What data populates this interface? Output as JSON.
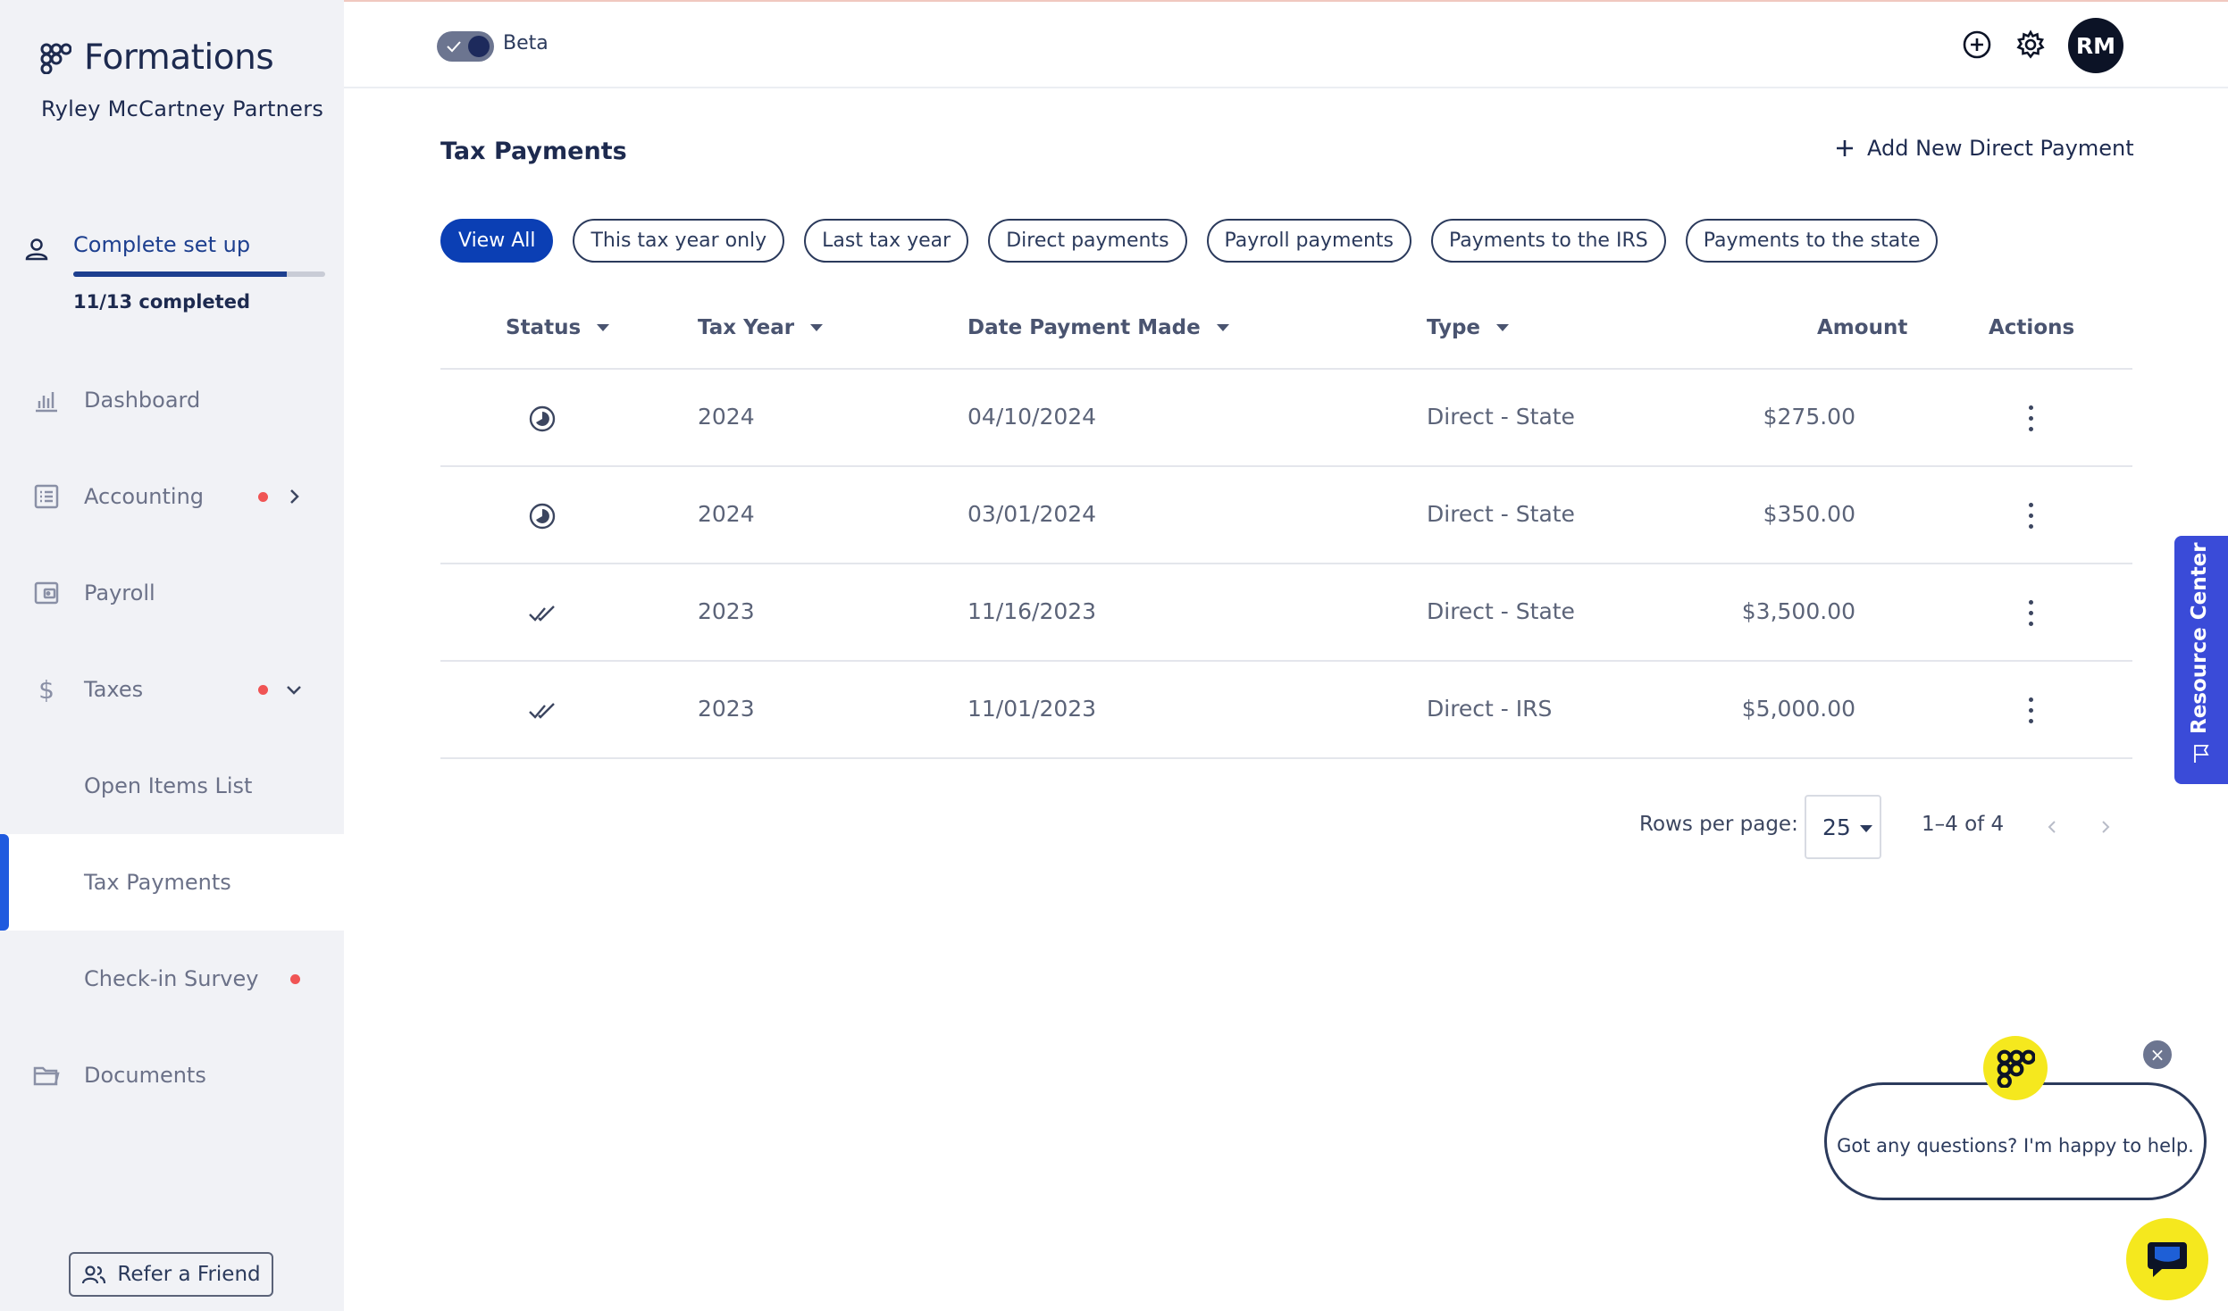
{
  "brand": {
    "name": "Formations",
    "company": "Ryley McCartney Partners"
  },
  "setup": {
    "label": "Complete set up",
    "count": "11/13 completed",
    "progress": 0.846
  },
  "nav": {
    "dashboard": "Dashboard",
    "accounting": "Accounting",
    "payroll": "Payroll",
    "taxes": "Taxes",
    "open_items": "Open Items List",
    "tax_payments": "Tax Payments",
    "checkin": "Check-in Survey",
    "documents": "Documents"
  },
  "refer": "Refer a Friend",
  "header": {
    "beta_label": "Beta",
    "avatar_initials": "RM"
  },
  "main": {
    "title": "Tax Payments",
    "add_button": "Add New Direct Payment",
    "filters": [
      "View All",
      "This tax year only",
      "Last tax year",
      "Direct payments",
      "Payroll payments",
      "Payments to the IRS",
      "Payments to the state"
    ],
    "columns": {
      "status": "Status",
      "tax_year": "Tax Year",
      "date": "Date Payment Made",
      "type": "Type",
      "amount": "Amount",
      "actions": "Actions"
    },
    "rows": [
      {
        "status": "pending-icon",
        "tax_year": "2024",
        "date": "04/10/2024",
        "type": "Direct - State",
        "amount": "$275.00"
      },
      {
        "status": "pending-icon",
        "tax_year": "2024",
        "date": "03/01/2024",
        "type": "Direct - State",
        "amount": "$350.00"
      },
      {
        "status": "double-check-icon",
        "tax_year": "2023",
        "date": "11/16/2023",
        "type": "Direct - State",
        "amount": "$3,500.00"
      },
      {
        "status": "double-check-icon",
        "tax_year": "2023",
        "date": "11/01/2023",
        "type": "Direct - IRS",
        "amount": "$5,000.00"
      }
    ],
    "pager": {
      "rows_label": "Rows per page:",
      "rows_value": "25",
      "range": "1–4 of 4"
    }
  },
  "resource_center": "Resource Center",
  "chat": {
    "message": "Got any questions? I'm happy to help.",
    "close": "×"
  },
  "colors": {
    "accent": "#0b3fb4",
    "sidebar": "#f1f2f6",
    "alert": "#f05454",
    "chat": "#f5e81e",
    "resource": "#3a4bd8"
  }
}
